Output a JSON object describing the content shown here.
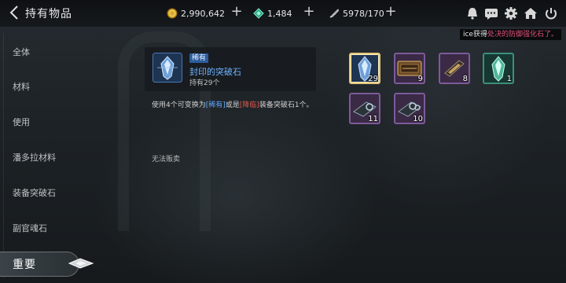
{
  "header": {
    "title": "持有物品",
    "resources": [
      {
        "name": "gold",
        "value": "2,990,642",
        "icon": "gold-coin-icon",
        "color": "#d9a92a"
      },
      {
        "name": "gem",
        "value": "1,484",
        "icon": "green-gem-icon",
        "color": "#3fc7a0"
      },
      {
        "name": "capacity",
        "value": "5978/170",
        "icon": "feather-icon",
        "color": "#c8c8c8"
      }
    ],
    "icons": [
      "bell-icon",
      "chat-icon",
      "gear-icon",
      "home-icon",
      "power-icon"
    ]
  },
  "notice": {
    "prefix": "ice获得",
    "highlight": "处决的防御强化石了。"
  },
  "sidebar": {
    "items": [
      {
        "label": "全体"
      },
      {
        "label": "材料"
      },
      {
        "label": "使用"
      },
      {
        "label": "潘多拉材料"
      },
      {
        "label": "装备突破石"
      },
      {
        "label": "副官魂石"
      },
      {
        "label": "重要"
      }
    ]
  },
  "detail": {
    "rarity": "稀有",
    "name": "封印的突破石",
    "owned": "持有29个",
    "desc_1": "使用4个可变换为",
    "desc_rare": "[稀有]",
    "desc_2": "或是",
    "desc_legend": "[降临]",
    "desc_3": "装备突破石1个。",
    "not_sellable": "无法贩卖"
  },
  "items": [
    {
      "count": "29",
      "type": "blue-crystal",
      "frame": "#e6c77a",
      "selected": true
    },
    {
      "count": "9",
      "type": "ticket",
      "frame": "#7d5a9a"
    },
    {
      "count": "8",
      "type": "scroll",
      "frame": "#7d5a9a"
    },
    {
      "count": "1",
      "type": "green-crystal",
      "frame": "#3c8f7a"
    },
    {
      "count": "11",
      "type": "box-ring",
      "frame": "#7d5a9a"
    },
    {
      "count": "10",
      "type": "box-ring",
      "frame": "#7d5a9a"
    }
  ]
}
